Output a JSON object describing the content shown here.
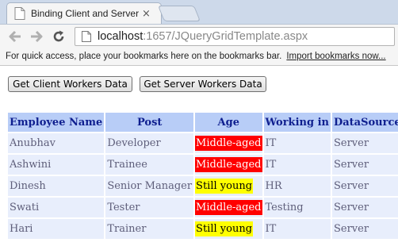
{
  "browser": {
    "tab_title": "Binding Client and Server",
    "tab_close": "×",
    "url_host": "localhost",
    "url_path": ":1657/JQueryGridTemplate.aspx",
    "bookmarks_text": "For quick access, place your bookmarks here on the bookmarks bar.",
    "bookmarks_link": "Import bookmarks now..."
  },
  "buttons": {
    "client": "Get Client Workers Data",
    "server": "Get Server Workers Data"
  },
  "grid": {
    "headers": [
      "Employee Name",
      "Post",
      "Age",
      "Working in",
      "DataSource"
    ],
    "age_colors": {
      "Middle-aged": {
        "bg": "#ff0000",
        "fg": "#ffffff"
      },
      "Still young": {
        "bg": "#ffff00",
        "fg": "#000000"
      }
    },
    "rows": [
      {
        "name": "Anubhav",
        "post": "Developer",
        "age": "Middle-aged",
        "dept": "IT",
        "source": "Server"
      },
      {
        "name": "Ashwini",
        "post": "Trainee",
        "age": "Middle-aged",
        "dept": "IT",
        "source": "Server"
      },
      {
        "name": "Dinesh",
        "post": "Senior Manager",
        "age": "Still young",
        "dept": "HR",
        "source": "Server"
      },
      {
        "name": "Swati",
        "post": "Tester",
        "age": "Middle-aged",
        "dept": "Testing",
        "source": "Server"
      },
      {
        "name": "Hari",
        "post": "Trainer",
        "age": "Still young",
        "dept": "IT",
        "source": "Server"
      }
    ]
  }
}
